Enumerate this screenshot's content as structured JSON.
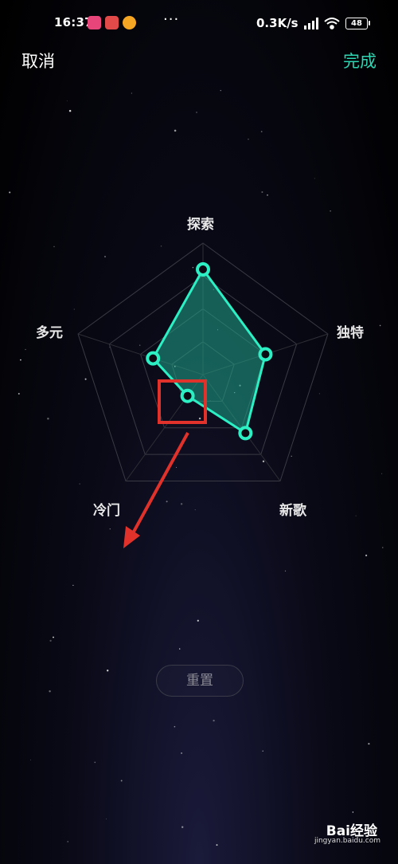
{
  "status_bar": {
    "time": "16:37",
    "dots": "···",
    "network_speed": "0.3K/s",
    "battery": "48"
  },
  "header": {
    "cancel_label": "取消",
    "done_label": "完成",
    "accent_color": "#2cd6b2"
  },
  "radar": {
    "axes": [
      {
        "label": "探索",
        "value": 0.8
      },
      {
        "label": "独特",
        "value": 0.5
      },
      {
        "label": "新歌",
        "value": 0.55
      },
      {
        "label": "冷门",
        "value": 0.2
      },
      {
        "label": "多元",
        "value": 0.4
      }
    ],
    "levels": 4,
    "fill_color": "#1fa68c",
    "line_color": "#2cf0c4"
  },
  "reset_label": "重置",
  "watermark": {
    "brand": "Bai经验",
    "url": "jingyan.baidu.com"
  }
}
